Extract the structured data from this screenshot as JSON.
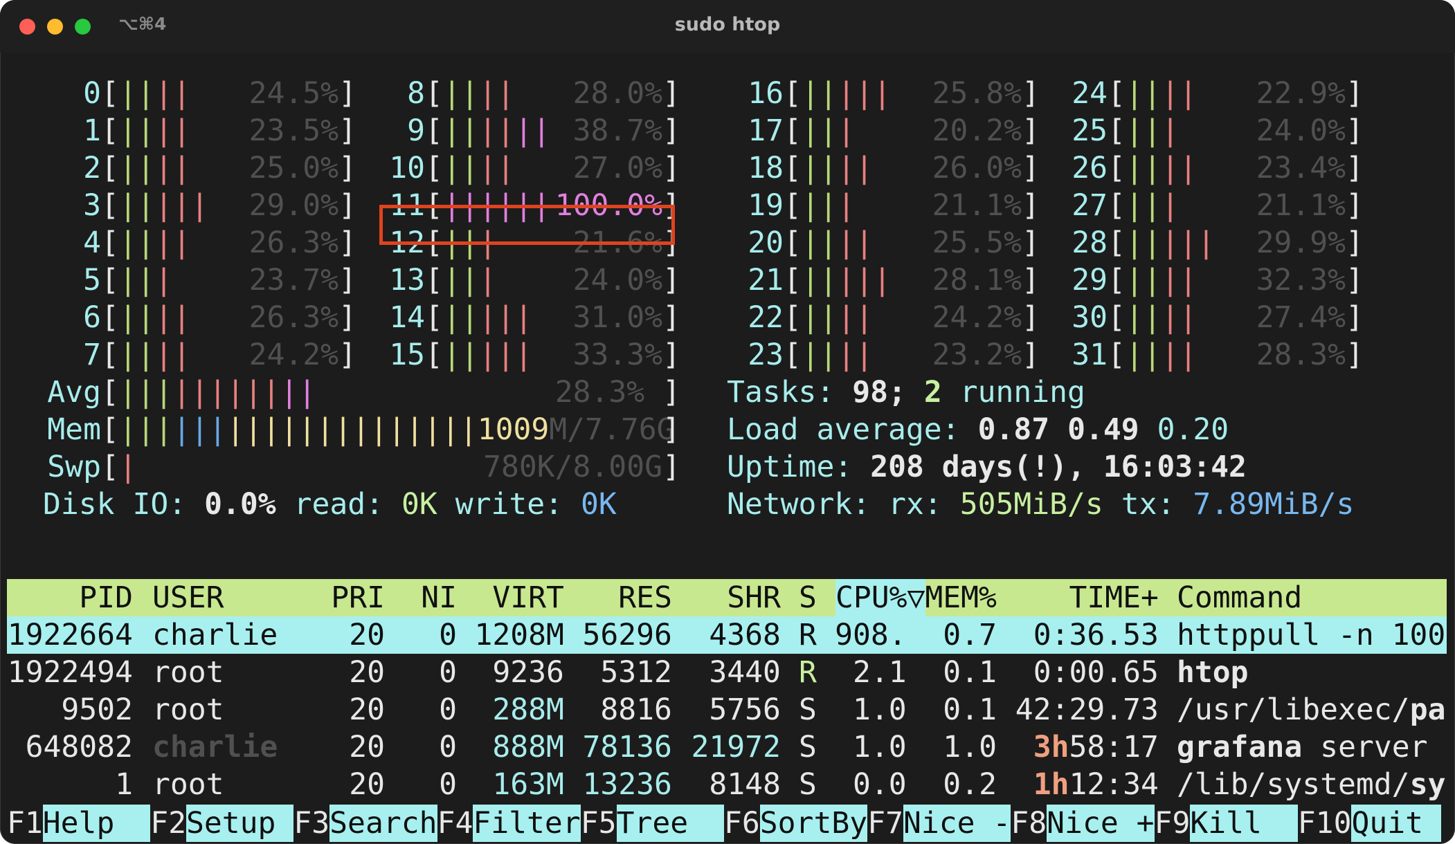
{
  "window": {
    "shortcut": "⌥⌘4",
    "title": "sudo htop",
    "light_colors": {
      "close": "#ff5f57",
      "minimize": "#febc2e",
      "zoom": "#28c840"
    }
  },
  "cpus": [
    {
      "id": "0",
      "bars": "||||",
      "pct": "24.5%"
    },
    {
      "id": "1",
      "bars": "||||",
      "pct": "23.5%"
    },
    {
      "id": "2",
      "bars": "||||",
      "pct": "25.0%"
    },
    {
      "id": "3",
      "bars": "|||||",
      "pct": "29.0%"
    },
    {
      "id": "4",
      "bars": "||||",
      "pct": "26.3%"
    },
    {
      "id": "5",
      "bars": "|||",
      "pct": "23.7%"
    },
    {
      "id": "6",
      "bars": "||||",
      "pct": "26.3%"
    },
    {
      "id": "7",
      "bars": "||||",
      "pct": "24.2%"
    },
    {
      "id": "8",
      "bars": "||||",
      "pct": "28.0%"
    },
    {
      "id": "9",
      "bars": "||||||",
      "pct": "38.7%"
    },
    {
      "id": "10",
      "bars": "||||",
      "pct": "27.0%"
    },
    {
      "id": "11",
      "bars": "||||||",
      "pct": "100.0%"
    },
    {
      "id": "12",
      "bars": "|||",
      "pct": "21.6%"
    },
    {
      "id": "13",
      "bars": "|||",
      "pct": "24.0%"
    },
    {
      "id": "14",
      "bars": "|||||",
      "pct": "31.0%"
    },
    {
      "id": "15",
      "bars": "|||||",
      "pct": "33.3%"
    },
    {
      "id": "16",
      "bars": "|||||",
      "pct": "25.8%"
    },
    {
      "id": "17",
      "bars": "|||",
      "pct": "20.2%"
    },
    {
      "id": "18",
      "bars": "||||",
      "pct": "26.0%"
    },
    {
      "id": "19",
      "bars": "|||",
      "pct": "21.1%"
    },
    {
      "id": "20",
      "bars": "||||",
      "pct": "25.5%"
    },
    {
      "id": "21",
      "bars": "|||||",
      "pct": "28.1%"
    },
    {
      "id": "22",
      "bars": "||||",
      "pct": "24.2%"
    },
    {
      "id": "23",
      "bars": "||||",
      "pct": "23.2%"
    },
    {
      "id": "24",
      "bars": "||||",
      "pct": "22.9%"
    },
    {
      "id": "25",
      "bars": "|||",
      "pct": "24.0%"
    },
    {
      "id": "26",
      "bars": "||||",
      "pct": "23.4%"
    },
    {
      "id": "27",
      "bars": "|||",
      "pct": "21.1%"
    },
    {
      "id": "28",
      "bars": "|||||",
      "pct": "29.9%"
    },
    {
      "id": "29",
      "bars": "||||",
      "pct": "32.3%"
    },
    {
      "id": "30",
      "bars": "||||",
      "pct": "27.4%"
    },
    {
      "id": "31",
      "bars": "||||",
      "pct": "28.3%"
    }
  ],
  "meters": {
    "avg": {
      "label": "Avg",
      "bars": "|||||||||||",
      "pct": "28.3%"
    },
    "mem": {
      "label": "Mem",
      "bars": "||||||||||||||||||||",
      "used": "1009",
      "total": "M/7.76G"
    },
    "swp": {
      "label": "Swp",
      "bars": "|",
      "value": "780K/8.00G"
    },
    "disk": {
      "label": "Disk IO:",
      "pct": "0.0%",
      "read_label": "read:",
      "read": "0K",
      "write_label": "write:",
      "write": "0K"
    }
  },
  "stats": {
    "tasks_label": "Tasks:",
    "tasks": "98;",
    "running": "2",
    "running_label": "running",
    "load_label": "Load average:",
    "load1": "0.87",
    "load5": "0.49",
    "load15": "0.20",
    "uptime_label": "Uptime:",
    "uptime": "208 days(!), 16:03:42",
    "network_label": "Network:",
    "rx_label": "rx:",
    "rx": "505MiB/s",
    "tx_label": "tx:",
    "tx": "7.89MiB/s"
  },
  "table": {
    "headers": {
      "pid": "PID",
      "user": "USER",
      "pri": "PRI",
      "ni": "NI",
      "virt": "VIRT",
      "res": "RES",
      "shr": "SHR",
      "s": "S",
      "cpu": "CPU%▽",
      "mem": "MEM%",
      "time": "TIME+",
      "command": "Command"
    },
    "rows": [
      {
        "pid": "1922664",
        "user": "charlie",
        "pri": "20",
        "ni": "0",
        "virt": "1208M",
        "res": "56296",
        "shr": "4368",
        "s": "R",
        "cpu": "908.",
        "mem": "0.7",
        "time": "0:36.53",
        "command": "httppull -n 100"
      },
      {
        "pid": "1922494",
        "user": "root",
        "pri": "20",
        "ni": "0",
        "virt": "9236",
        "res": "5312",
        "shr": "3440",
        "s": "R",
        "cpu": "2.1",
        "mem": "0.1",
        "time": "0:00.65",
        "command": "htop"
      },
      {
        "pid": "9502",
        "user": "root",
        "pri": "20",
        "ni": "0",
        "virt": "288M",
        "res": "8816",
        "shr": "5756",
        "s": "S",
        "cpu": "1.0",
        "mem": "0.1",
        "time": "42:29.73",
        "cmd_a": "/usr/libexec/",
        "cmd_b": "pa"
      },
      {
        "pid": "648082",
        "user": "charlie",
        "pri": "20",
        "ni": "0",
        "virt": "888M",
        "res": "78136",
        "shr": "21972",
        "s": "S",
        "cpu": "1.0",
        "mem": "1.0",
        "time_h": "3h",
        "time_rest": "58:17",
        "cmd_a": "grafana",
        "cmd_b": " server"
      },
      {
        "pid": "1",
        "user": "root",
        "pri": "20",
        "ni": "0",
        "virt": "163M",
        "res": "13236",
        "shr": "8148",
        "s": "S",
        "cpu": "0.0",
        "mem": "0.2",
        "time_h": "1h",
        "time_rest": "12:34",
        "cmd_a": "/lib/systemd/",
        "cmd_b": "sy"
      }
    ]
  },
  "fkeys": [
    {
      "key": "F1",
      "label": "Help  "
    },
    {
      "key": "F2",
      "label": "Setup "
    },
    {
      "key": "F3",
      "label": "Search"
    },
    {
      "key": "F4",
      "label": "Filter"
    },
    {
      "key": "F5",
      "label": "Tree  "
    },
    {
      "key": "F6",
      "label": "SortBy"
    },
    {
      "key": "F7",
      "label": "Nice -"
    },
    {
      "key": "F8",
      "label": "Nice +"
    },
    {
      "key": "F9",
      "label": "Kill  "
    },
    {
      "key": "F10",
      "label": "Quit "
    }
  ]
}
